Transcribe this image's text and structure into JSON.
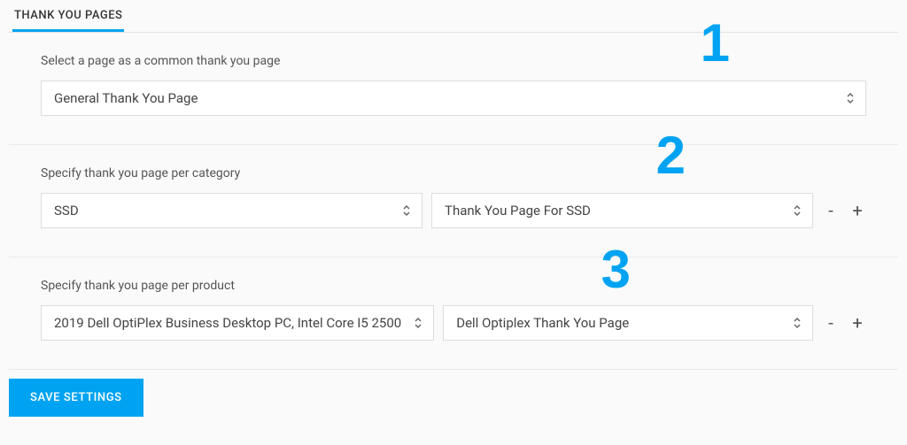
{
  "tab": {
    "label": "THANK YOU PAGES"
  },
  "annotations": {
    "n1": "1",
    "n2": "2",
    "n3": "3"
  },
  "common": {
    "label": "Select a page as a common thank you page",
    "value": "General Thank You Page"
  },
  "category": {
    "label": "Specify thank you page per category",
    "left": "SSD",
    "right": "Thank You Page For SSD"
  },
  "product": {
    "label": "Specify thank you page per product",
    "left": "2019 Dell OptiPlex Business Desktop PC, Intel Core I5 2500",
    "right": "Dell Optiplex Thank You Page"
  },
  "footer": {
    "save": "SAVE SETTINGS"
  },
  "icons": {
    "plus": "+",
    "minus": "-"
  }
}
